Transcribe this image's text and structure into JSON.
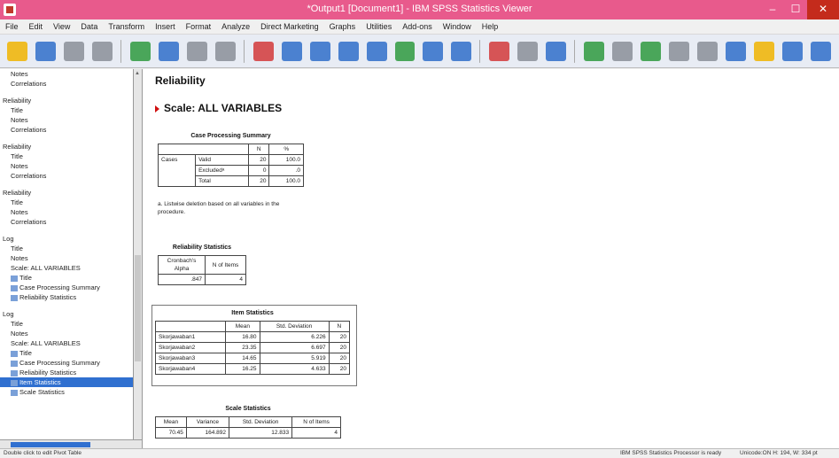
{
  "window": {
    "title": "*Output1 [Document1] - IBM SPSS Statistics Viewer"
  },
  "menu": [
    "File",
    "Edit",
    "View",
    "Data",
    "Transform",
    "Insert",
    "Format",
    "Analyze",
    "Direct Marketing",
    "Graphs",
    "Utilities",
    "Add-ons",
    "Window",
    "Help"
  ],
  "toolbar": {
    "icons": [
      "open-folder-icon",
      "save-icon",
      "print-icon",
      "print-preview-icon",
      "export-icon",
      "recall-dialog-icon",
      "undo-icon",
      "redo-icon",
      "goto-data-icon",
      "goto-case-icon",
      "variables-icon",
      "chart-icon",
      "designate-window-icon",
      "script-icon",
      "select-icon",
      "show-all-icon",
      "insert-heading-icon",
      "insert-title-icon",
      "insert-text-icon",
      "promote-icon",
      "demote-icon",
      "expand-icon",
      "collapse-icon",
      "show-icon",
      "hide-icon",
      "insert-chart-icon",
      "insert-table-icon",
      "insert-text-file-icon"
    ],
    "colors": {
      "yellow": "#f0b400",
      "blue": "#2f6fc9",
      "red": "#d23a3a",
      "green": "#2e9a3e",
      "gray": "#8a8f98"
    }
  },
  "outline": [
    {
      "label": "Notes",
      "level": 1
    },
    {
      "label": "Correlations",
      "level": 1
    },
    {
      "gap": true
    },
    {
      "label": "Reliability",
      "level": 0
    },
    {
      "label": "Title",
      "level": 1
    },
    {
      "label": "Notes",
      "level": 1
    },
    {
      "label": "Correlations",
      "level": 1
    },
    {
      "gap": true
    },
    {
      "label": "Reliability",
      "level": 0
    },
    {
      "label": "Title",
      "level": 1
    },
    {
      "label": "Notes",
      "level": 1
    },
    {
      "label": "Correlations",
      "level": 1
    },
    {
      "gap": true
    },
    {
      "label": "Reliability",
      "level": 0
    },
    {
      "label": "Title",
      "level": 1
    },
    {
      "label": "Notes",
      "level": 1
    },
    {
      "label": "Correlations",
      "level": 1
    },
    {
      "gap": true
    },
    {
      "label": "Log",
      "level": 0
    },
    {
      "label": "Title",
      "level": 1
    },
    {
      "label": "Notes",
      "level": 1
    },
    {
      "label": "Scale: ALL VARIABLES",
      "level": 1
    },
    {
      "label": "Title",
      "level": 1,
      "icon": true
    },
    {
      "label": "Case Processing Summary",
      "level": 1,
      "icon": true
    },
    {
      "label": "Reliability Statistics",
      "level": 1,
      "icon": true
    },
    {
      "gap": true
    },
    {
      "label": "Log",
      "level": 0
    },
    {
      "label": "Title",
      "level": 1
    },
    {
      "label": "Notes",
      "level": 1
    },
    {
      "label": "Scale: ALL VARIABLES",
      "level": 1
    },
    {
      "label": "Title",
      "level": 1,
      "icon": true
    },
    {
      "label": "Case Processing Summary",
      "level": 1,
      "icon": true
    },
    {
      "label": "Reliability Statistics",
      "level": 1,
      "icon": true
    },
    {
      "label": "Item Statistics",
      "level": 1,
      "icon": true,
      "selected": true
    },
    {
      "label": "Scale Statistics",
      "level": 1,
      "icon": true
    }
  ],
  "output": {
    "heading": "Reliability",
    "scale_heading": "Scale: ALL VARIABLES",
    "case_processing": {
      "title": "Case Processing Summary",
      "headers": [
        "",
        "",
        "N",
        "%"
      ],
      "rows": [
        [
          "Cases",
          "Valid",
          "20",
          "100.0"
        ],
        [
          "",
          "Excludedᵃ",
          "0",
          ".0"
        ],
        [
          "",
          "Total",
          "20",
          "100.0"
        ]
      ],
      "footnote": "a. Listwise deletion based on all variables in the procedure."
    },
    "reliability": {
      "title": "Reliability Statistics",
      "headers": [
        "Cronbach's Alpha",
        "N of Items"
      ],
      "row": [
        ".847",
        "4"
      ]
    },
    "item_stats": {
      "title": "Item Statistics",
      "headers": [
        "",
        "Mean",
        "Std. Deviation",
        "N"
      ],
      "rows": [
        [
          "Skorjawaban1",
          "16.80",
          "6.226",
          "20"
        ],
        [
          "Skorjawaban2",
          "23.35",
          "6.697",
          "20"
        ],
        [
          "Skorjawaban3",
          "14.65",
          "5.919",
          "20"
        ],
        [
          "Skorjawaban4",
          "16.25",
          "4.633",
          "20"
        ]
      ]
    },
    "scale_stats": {
      "title": "Scale Statistics",
      "headers": [
        "Mean",
        "Variance",
        "Std. Deviation",
        "N of Items"
      ],
      "row": [
        "70.45",
        "164.892",
        "12.833",
        "4"
      ]
    }
  },
  "status": {
    "left": "Double click to edit Pivot Table",
    "middle": "IBM SPSS Statistics Processor is ready",
    "right": "Unicode:ON  H: 194, W: 334 pt"
  }
}
